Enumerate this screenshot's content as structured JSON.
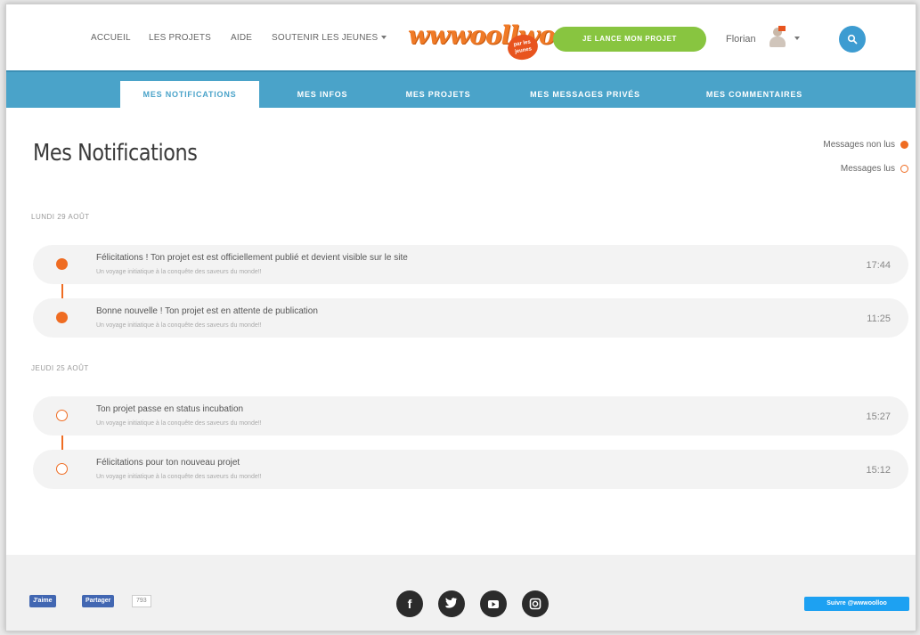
{
  "header": {
    "nav": [
      {
        "label": "ACCUEIL"
      },
      {
        "label": "LES PROJETS"
      },
      {
        "label": "AIDE"
      },
      {
        "label": "SOUTENIR LES JEUNES"
      }
    ],
    "logo_text": "wwwoollwo",
    "logo_badge": "par les jeunes",
    "cta_label": "JE LANCE MON PROJET",
    "user_name": "Florian",
    "accent_orange": "#ef6c22",
    "accent_blue": "#4aa3c9",
    "accent_green": "#88c540"
  },
  "tabs": [
    {
      "label": "MES NOTIFICATIONS",
      "active": true
    },
    {
      "label": "MES INFOS"
    },
    {
      "label": "MES PROJETS"
    },
    {
      "label": "MES MESSAGES PRIVÉS"
    },
    {
      "label": "MES COMMENTAIRES"
    }
  ],
  "main": {
    "title": "Mes Notifications",
    "legend": {
      "unread": "Messages non lus",
      "read": "Messages lus"
    },
    "groups": [
      {
        "day": "LUNDI 29 AOÛT",
        "items": [
          {
            "title": "Félicitations ! Ton projet est est officiellement publié et devient visible sur le site",
            "subtitle": "Un voyage initiatique à la conquête des saveurs du monde!!",
            "time": "17:44",
            "state": "unread"
          },
          {
            "title": "Bonne nouvelle ! Ton projet est en attente de publication",
            "subtitle": "Un voyage initiatique à la conquête des saveurs du monde!!",
            "time": "11:25",
            "state": "unread"
          }
        ]
      },
      {
        "day": "JEUDI 25 AOÛT",
        "items": [
          {
            "title": "Ton projet passe en status incubation",
            "subtitle": "Un voyage initiatique à la conquête des saveurs du monde!!",
            "time": "15:27",
            "state": "read"
          },
          {
            "title": "Félicitations pour ton nouveau projet",
            "subtitle": "Un voyage initiatique à la conquête des saveurs du monde!!",
            "time": "15:12",
            "state": "read"
          }
        ]
      }
    ]
  },
  "footer": {
    "fb_like": "J'aime",
    "fb_share": "Partager",
    "fb_count": "793",
    "social_icons": [
      "facebook-icon",
      "twitter-icon",
      "youtube-icon",
      "instagram-icon"
    ],
    "twitter_follow": "Suivre @wwwoolloo"
  }
}
